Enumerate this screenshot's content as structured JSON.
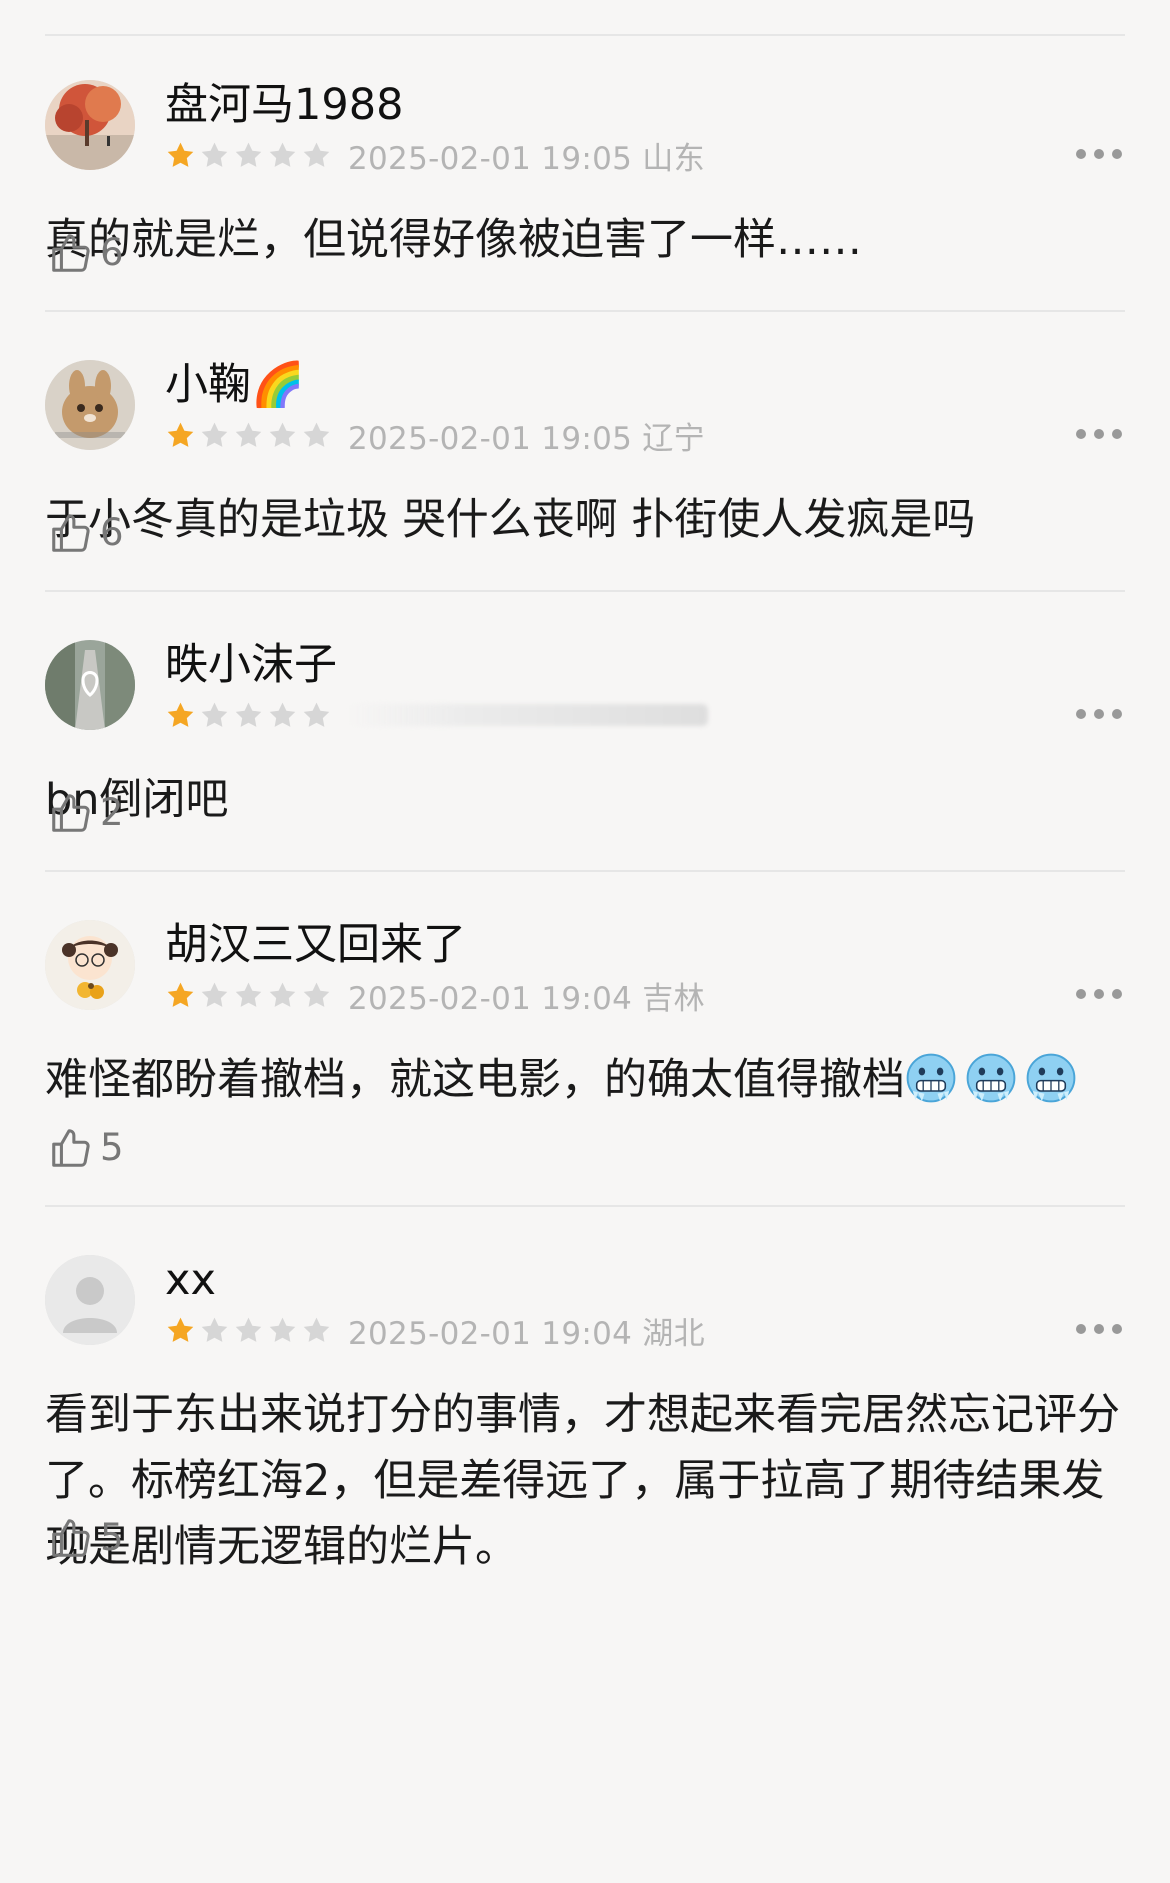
{
  "reviews": [
    {
      "username": "盘河马1988",
      "rating": 1,
      "max_rating": 5,
      "timestamp": "2025-02-01 19:05 山东",
      "comment": "真的就是烂，但说得好像被迫害了一样……",
      "likes": "6"
    },
    {
      "username": "小鞠🌈",
      "rating": 1,
      "max_rating": 5,
      "timestamp": "2025-02-01 19:05 辽宁",
      "comment": "于小冬真的是垃圾 哭什么丧啊 扑街使人发疯是吗",
      "likes": "6"
    },
    {
      "username": "昳小沫子",
      "rating": 1,
      "max_rating": 5,
      "timestamp": "",
      "comment": "bn倒闭吧",
      "likes": "2"
    },
    {
      "username": "胡汉三又回来了",
      "rating": 1,
      "max_rating": 5,
      "timestamp": "2025-02-01 19:04 吉林",
      "comment": "难怪都盼着撤档，就这电影，的确太值得撤档",
      "comment_emoji": "cold-face-emoji",
      "comment_emoji_count": 3,
      "likes": "5"
    },
    {
      "username": "xx",
      "rating": 1,
      "max_rating": 5,
      "timestamp": "2025-02-01 19:04 湖北",
      "comment": "看到于东出来说打分的事情，才想起来看完居然忘记评分了。标榜红海2，但是差得远了，属于拉高了期待结果发现是剧情无逻辑的烂片。",
      "likes": "5"
    }
  ],
  "colors": {
    "star_filled": "#f5a623",
    "star_empty": "#d6d6d6",
    "meta_text": "#b4b4b4",
    "divider": "#e6e6e6",
    "background": "#f7f6f5"
  },
  "icons": {
    "more": "more-horizontal-icon",
    "like": "thumbs-up-icon",
    "star": "star-icon"
  }
}
